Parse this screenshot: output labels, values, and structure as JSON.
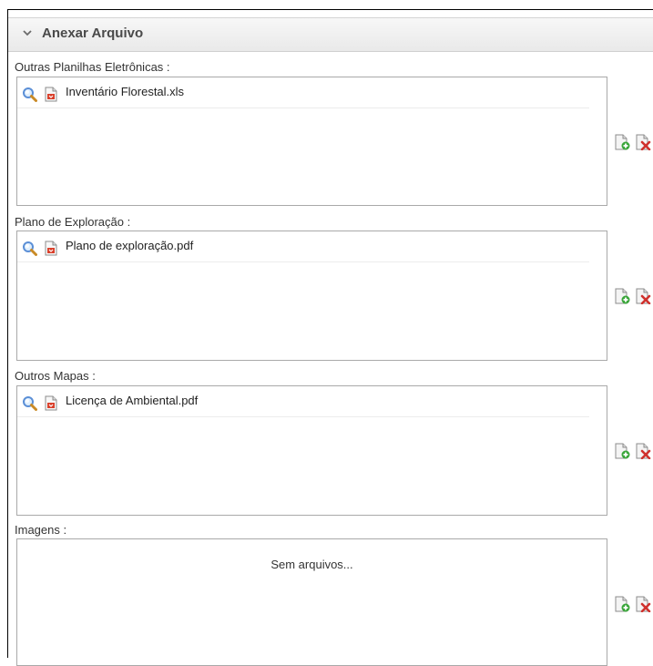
{
  "panel": {
    "title": "Anexar Arquivo"
  },
  "sections": [
    {
      "label": "Outras Planilhas Eletrônicas :",
      "files": [
        "Inventário Florestal.xls"
      ]
    },
    {
      "label": "Plano de Exploração :",
      "files": [
        "Plano de exploração.pdf"
      ]
    },
    {
      "label": "Outros Mapas :",
      "files": [
        "Licença de Ambiental.pdf"
      ]
    },
    {
      "label": "Imagens :",
      "files": [],
      "empty_text": "Sem arquivos..."
    }
  ],
  "icons": {
    "toggle": "chevron-down-icon",
    "preview": "magnifier-icon",
    "file": "pdf-file-icon",
    "add": "add-file-icon",
    "remove": "remove-file-icon"
  },
  "colors": {
    "header_bg": "#ececec",
    "border": "#a9a9a9"
  }
}
